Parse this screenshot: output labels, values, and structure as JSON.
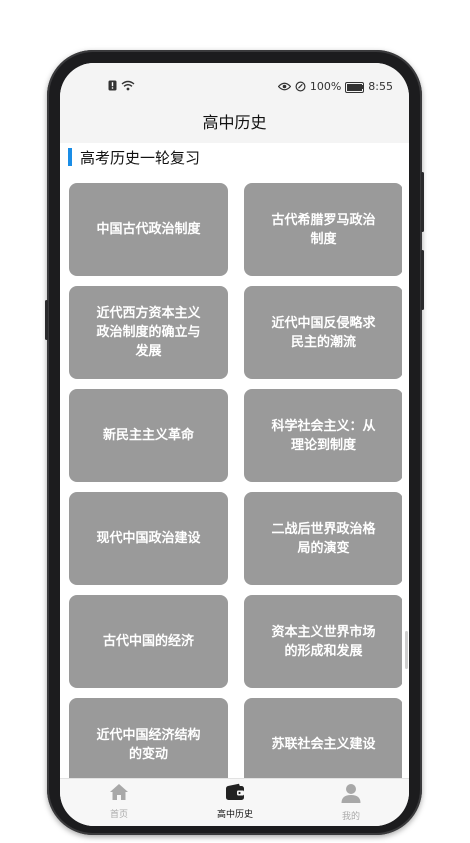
{
  "status_bar": {
    "left_icons": [
      "sim-alert-icon",
      "wifi-icon"
    ],
    "eye_icon": "eye-icon",
    "data_icon": "data-saver-icon",
    "battery_percent": "100%",
    "time": "8:55"
  },
  "header": {
    "title": "高中历史"
  },
  "section": {
    "title": "高考历史一轮复习"
  },
  "cards": [
    "中国古代政治制度",
    "古代希腊罗马政治制度",
    "近代西方资本主义政治制度的确立与发展",
    "近代中国反侵略求民主的潮流",
    "新民主主义革命",
    "科学社会主义：从理论到制度",
    "现代中国政治建设",
    "二战后世界政治格局的演变",
    "古代中国的经济",
    "资本主义世界市场的形成和发展",
    "近代中国经济结构的变动",
    "苏联社会主义建设"
  ],
  "tabbar": {
    "tabs": [
      {
        "label": "首页",
        "icon": "home-icon",
        "active": false
      },
      {
        "label": "高中历史",
        "icon": "wallet-icon",
        "active": true
      },
      {
        "label": "我的",
        "icon": "person-icon",
        "active": false
      }
    ]
  },
  "colors": {
    "accent": "#1a8de6",
    "card_bg": "#9a9a9a",
    "header_bg": "#f4f4f4"
  }
}
